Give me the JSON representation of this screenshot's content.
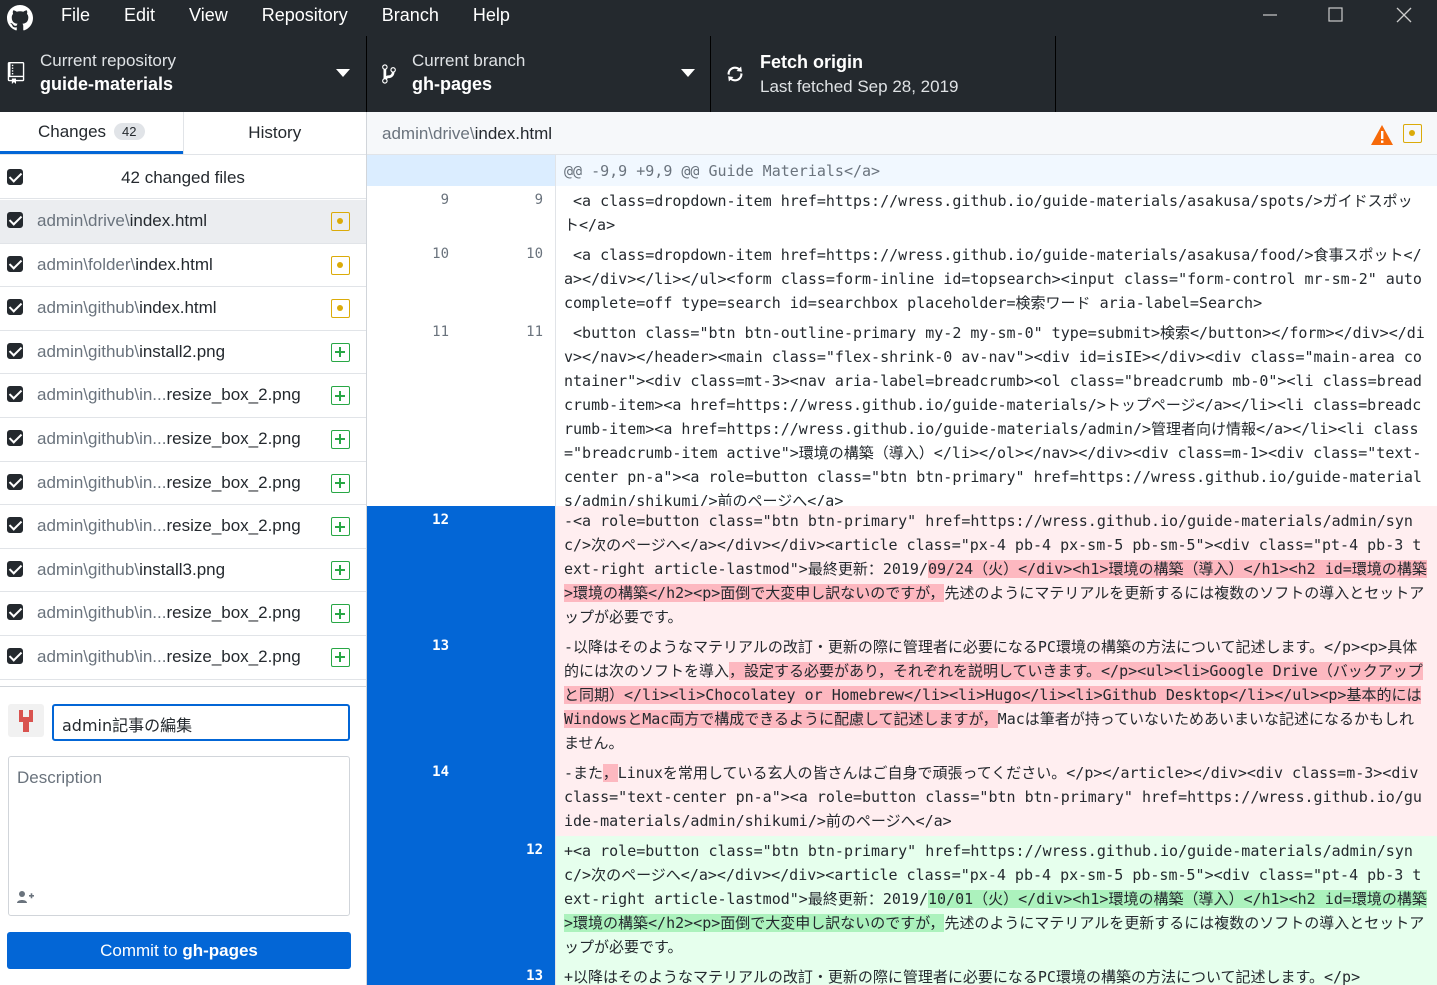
{
  "menu": [
    "File",
    "Edit",
    "View",
    "Repository",
    "Branch",
    "Help"
  ],
  "toolbar": {
    "repo_label": "Current repository",
    "repo_value": "guide-materials",
    "branch_label": "Current branch",
    "branch_value": "gh-pages",
    "fetch_label": "Fetch origin",
    "fetch_value": "Last fetched Sep 28, 2019"
  },
  "tabs": {
    "changes": "Changes",
    "changes_count": "42",
    "history": "History"
  },
  "files_header": "42 changed files",
  "files": [
    {
      "dir": "admin\\drive\\",
      "name": "index.html",
      "status": "modified"
    },
    {
      "dir": "admin\\folder\\",
      "name": "index.html",
      "status": "modified"
    },
    {
      "dir": "admin\\github\\",
      "name": "index.html",
      "status": "modified"
    },
    {
      "dir": "admin\\github\\",
      "name": "install2.png",
      "status": "added"
    },
    {
      "dir": "admin\\github\\in...",
      "name": "resize_box_2.png",
      "status": "added"
    },
    {
      "dir": "admin\\github\\in...",
      "name": "resize_box_2.png",
      "status": "added"
    },
    {
      "dir": "admin\\github\\in...",
      "name": "resize_box_2.png",
      "status": "added"
    },
    {
      "dir": "admin\\github\\in...",
      "name": "resize_box_2.png",
      "status": "added"
    },
    {
      "dir": "admin\\github\\",
      "name": "install3.png",
      "status": "added"
    },
    {
      "dir": "admin\\github\\in...",
      "name": "resize_box_2.png",
      "status": "added"
    },
    {
      "dir": "admin\\github\\in...",
      "name": "resize_box_2.png",
      "status": "added"
    }
  ],
  "commit": {
    "summary": "admin記事の編集",
    "description_placeholder": "Description",
    "button_prefix": "Commit to ",
    "button_branch": "gh-pages"
  },
  "diff": {
    "dir": "admin\\drive\\",
    "name": "index.html",
    "hunk": "@@ -9,9 +9,9 @@ Guide Materials</a>",
    "lines": [
      {
        "old": "9",
        "new": "9",
        "type": "ctx",
        "text": " <a class=dropdown-item href=https://wress.github.io/guide-materials/asakusa/spots/>ガイドスポット</a>"
      },
      {
        "old": "10",
        "new": "10",
        "type": "ctx",
        "text": " <a class=dropdown-item href=https://wress.github.io/guide-materials/asakusa/food/>食事スポット</a></div></li></ul><form class=form-inline id=topsearch><input class=\"form-control mr-sm-2\" autocomplete=off type=search id=searchbox placeholder=検索ワード aria-label=Search>"
      },
      {
        "old": "11",
        "new": "11",
        "type": "ctx",
        "text": " <button class=\"btn btn-outline-primary my-2 my-sm-0\" type=submit>検索</button></form></div></div></nav></header><main class=\"flex-shrink-0 av-nav\"><div id=isIE></div><div class=\"main-area container\"><div class=mt-3><nav aria-label=breadcrumb><ol class=\"breadcrumb mb-0\"><li class=breadcrumb-item><a href=https://wress.github.io/guide-materials/>トップページ</a></li><li class=breadcrumb-item><a href=https://wress.github.io/guide-materials/admin/>管理者向け情報</a></li><li class=\"breadcrumb-item active\">環境の構築（導入）</li></ol></nav></div><div class=m-1><div class=\"text-center pn-a\"><a role=button class=\"btn btn-primary\" href=https://wress.github.io/guide-materials/admin/shikumi/>前のページへ</a>"
      },
      {
        "old": "12",
        "new": "",
        "type": "del",
        "pre": "-<a role=button class=\"btn btn-primary\" href=https://wress.github.io/guide-materials/admin/sync/>次のページへ</a></div></div><article class=\"px-4 pb-4 px-sm-5 pb-sm-5\"><div class=\"pt-4 pb-3 text-right article-lastmod\">最終更新：2019/",
        "hl": "09/24（火）</div><h1>環境の構築（導入）</h1><h2 id=環境の構築>環境の構築</h2><p>面倒で大変申し訳ないのですが，",
        "post": "先述のようにマテリアルを更新するには複数のソフトの導入とセットアップが必要です。"
      },
      {
        "old": "13",
        "new": "",
        "type": "del",
        "pre": "-以降はそのようなマテリアルの改訂・更新の際に管理者に必要になるPC環境の構築の方法について記述します。</p><p>具体的には次のソフトを導入",
        "hl": "，設定する必要があり，それぞれを説明していきます。</p><ul><li>Google Drive（バックアップと同期）</li><li>Chocolatey or Homebrew</li><li>Hugo</li><li>Github Desktop</li></ul><p>基本的にはWindowsとMac両方で構成できるように配慮して記述しますが，",
        "post": "Macは筆者が持っていないためあいまいな記述になるかもしれません。"
      },
      {
        "old": "14",
        "new": "",
        "type": "del",
        "pre": "-また",
        "hl": "，",
        "post": "Linuxを常用している玄人の皆さんはご自身で頑張ってください。</p></article></div><div class=m-3><div class=\"text-center pn-a\"><a role=button class=\"btn btn-primary\" href=https://wress.github.io/guide-materials/admin/shikumi/>前のページへ</a>"
      },
      {
        "old": "",
        "new": "12",
        "type": "add",
        "pre": "+<a role=button class=\"btn btn-primary\" href=https://wress.github.io/guide-materials/admin/sync/>次のページへ</a></div></div><article class=\"px-4 pb-4 px-sm-5 pb-sm-5\"><div class=\"pt-4 pb-3 text-right article-lastmod\">最終更新：2019/",
        "hl": "10/01（火）</div><h1>環境の構築（導入）</h1><h2 id=環境の構築>環境の構築</h2><p>面倒で大変申し訳ないのですが，",
        "post": "先述のようにマテリアルを更新するには複数のソフトの導入とセットアップが必要です。"
      },
      {
        "old": "",
        "new": "13",
        "type": "add",
        "pre": "+以降はそのようなマテリアルの改訂・更新の際に管理者に必要になるPC環境の構築の方法について記述します。</p>",
        "hl": "",
        "post": ""
      }
    ]
  },
  "colors": {
    "chrome": "#24292e",
    "accent": "#0366d6",
    "modified": "#dbab09",
    "added": "#28a745",
    "warning": "#f66a0a"
  }
}
